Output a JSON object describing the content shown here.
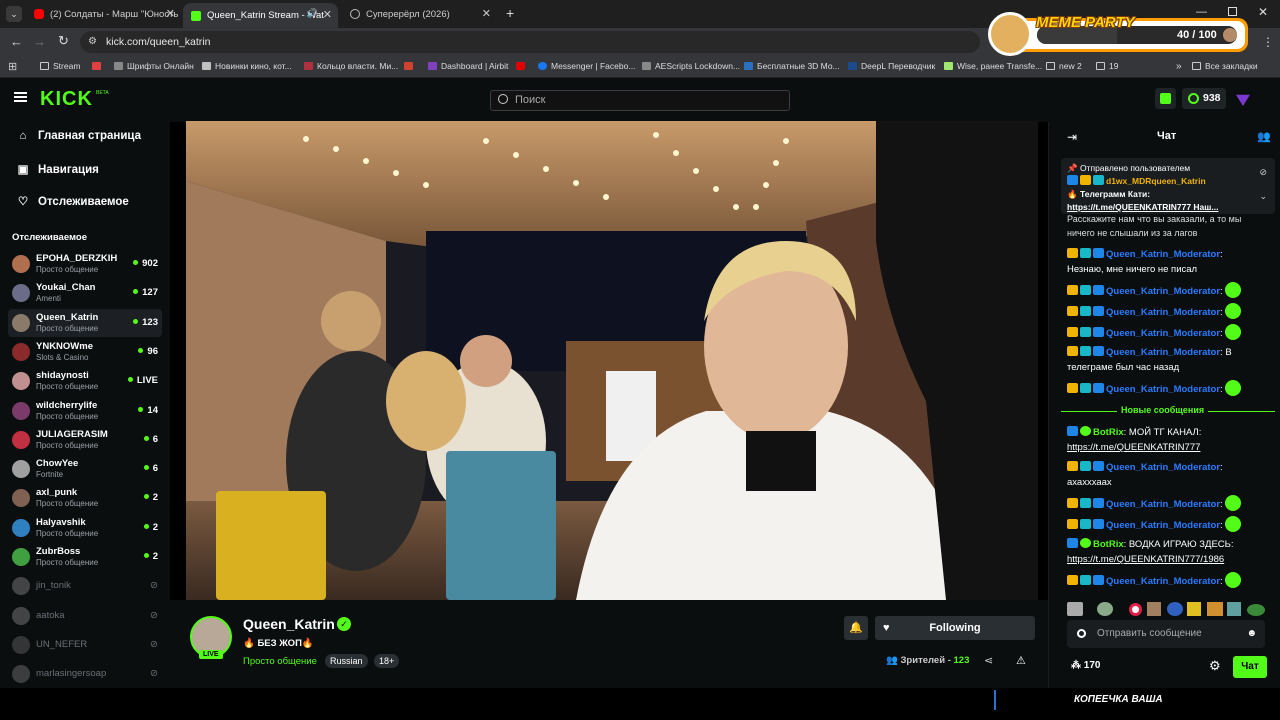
{
  "browser": {
    "tabs": [
      {
        "title": "(2) Солдаты - Марш \"Юность \"",
        "favicon": "youtube",
        "active": false
      },
      {
        "title": "Queen_Katrin Stream - Wat",
        "favicon": "kick",
        "active": true
      },
      {
        "title": "Суперерёрл (2026)",
        "favicon": "globe",
        "active": false
      }
    ],
    "new_tab": "+",
    "url": "kick.com/queen_katrin",
    "bookmarks": [
      "Stream",
      "",
      "Шрифты Онлайн",
      "Новинки кино, кот...",
      "Кольцо власти. Ми...",
      "",
      "Dashboard | Airbit",
      "",
      "Messenger | Facebo...",
      "AEScripts Lockdown...",
      "Бесплатные 3D Мо...",
      "DeepL Переводчик",
      "Wise, ранее Transfe...",
      "new 2",
      "19"
    ],
    "all_bookmarks": "Все закладки",
    "overflow": "»"
  },
  "overlay": {
    "title": "MEME PARTY",
    "progress_text": "40 / 100",
    "progress_value": 0.4
  },
  "header": {
    "logo": "KICK",
    "logo_tag": "BETA",
    "search_placeholder": "Поиск",
    "points": "938"
  },
  "sidebar": {
    "nav": [
      {
        "label": "Главная страница",
        "icon": "home-icon"
      },
      {
        "label": "Навигация",
        "icon": "compass-icon"
      },
      {
        "label": "Отслеживаемое",
        "icon": "heart-icon"
      }
    ],
    "section_title": "Отслеживаемое",
    "channels": [
      {
        "name": "EPOHA_DERZKIH",
        "category": "Просто общение",
        "viewers": "902",
        "live": true,
        "color": "#b07050"
      },
      {
        "name": "Youkai_Chan",
        "category": "Amenti",
        "viewers": "127",
        "live": true,
        "color": "#6b6b8a"
      },
      {
        "name": "Queen_Katrin",
        "category": "Просто общение",
        "viewers": "123",
        "live": true,
        "color": "#8a7a6a",
        "selected": true
      },
      {
        "name": "YNKNOWme",
        "category": "Slots & Casino",
        "viewers": "96",
        "live": true,
        "color": "#8a2a2a"
      },
      {
        "name": "shidaynosti",
        "category": "Просто общение",
        "viewers": "LIVE",
        "live": true,
        "color": "#c09090"
      },
      {
        "name": "wildcherrylife",
        "category": "Просто общение",
        "viewers": "14",
        "live": true,
        "color": "#7a3a6a"
      },
      {
        "name": "JULIAGERASIM",
        "category": "Просто общение",
        "viewers": "6",
        "live": true,
        "color": "#c03040"
      },
      {
        "name": "ChowYee",
        "category": "Fortnite",
        "viewers": "6",
        "live": true,
        "color": "#a0a0a0"
      },
      {
        "name": "axl_punk",
        "category": "Просто общение",
        "viewers": "2",
        "live": true,
        "color": "#806050"
      },
      {
        "name": "Halyavshik",
        "category": "Просто общение",
        "viewers": "2",
        "live": true,
        "color": "#3080c0"
      },
      {
        "name": "ZubrBoss",
        "category": "Просто общение",
        "viewers": "2",
        "live": true,
        "color": "#40a040"
      },
      {
        "name": "jin_tonik",
        "category": "",
        "viewers": "",
        "live": false,
        "color": "#888"
      },
      {
        "name": "aatoka",
        "category": "",
        "viewers": "",
        "live": false,
        "color": "#888"
      },
      {
        "name": "UN_NEFER",
        "category": "",
        "viewers": "",
        "live": false,
        "color": "#666"
      },
      {
        "name": "marlasingersoap",
        "category": "",
        "viewers": "",
        "live": false,
        "color": "#777"
      }
    ]
  },
  "stream": {
    "streamer": "Queen_Katrin",
    "live_badge": "LIVE",
    "title": "🔥 БЕЗ ЖОП🔥",
    "category": "Просто общение",
    "tags": [
      "Russian",
      "18+"
    ],
    "follow_label": "Following",
    "viewers_label": "Зрителей -",
    "viewers": "123"
  },
  "chat": {
    "title": "Чат",
    "pinned_header": "Отправлено пользователем",
    "pinned_user": "d1wx_MDRqueen_Katrin",
    "pinned_line1": "🔥 Телеграмм Кати:",
    "pinned_line2": "https://t.me/QUEENKATRIN777 Наш...",
    "partial_msg": "Расскажите нам что вы заказали, а то мы ничего не слышали из за лагов",
    "messages": [
      {
        "user": "Queen_Katrin_Moderator",
        "text": "Незнаю, мне ничего не писал"
      },
      {
        "user": "Queen_Katrin_Moderator",
        "text": ""
      },
      {
        "user": "Queen_Katrin_Moderator",
        "text": ""
      },
      {
        "user": "Queen_Katrin_Moderator",
        "text": ""
      },
      {
        "user": "Queen_Katrin_Moderator",
        "text": "В телеграме был час назад"
      },
      {
        "user": "Queen_Katrin_Moderator",
        "text": ""
      }
    ],
    "new_messages": "Новые сообщения",
    "messages2": [
      {
        "user": "BotRix",
        "text": "МОЙ ТГ КАНАЛ:",
        "link": "https://t.me/QUEENKATRIN777"
      },
      {
        "user": "Queen_Katrin_Moderator",
        "text": "ахахххаах"
      },
      {
        "user": "Queen_Katrin_Moderator",
        "text": ""
      },
      {
        "user": "Queen_Katrin_Moderator",
        "text": ""
      },
      {
        "user": "BotRix",
        "text": "ВОДКА ИГРАЮ ЗДЕСЬ:",
        "link": "https://t.me/QUEENKATRIN777/1986"
      },
      {
        "user": "Queen_Katrin_Moderator",
        "text": ""
      }
    ],
    "input_placeholder": "Отправить сообщение",
    "points": "170",
    "send_label": "Чат"
  },
  "bottom_caption": "КОПЕЕЧКА ВАША",
  "colors": {
    "accent": "#53fc18",
    "bg": "#0b0e0f",
    "mod_name": "#2b7bff"
  }
}
